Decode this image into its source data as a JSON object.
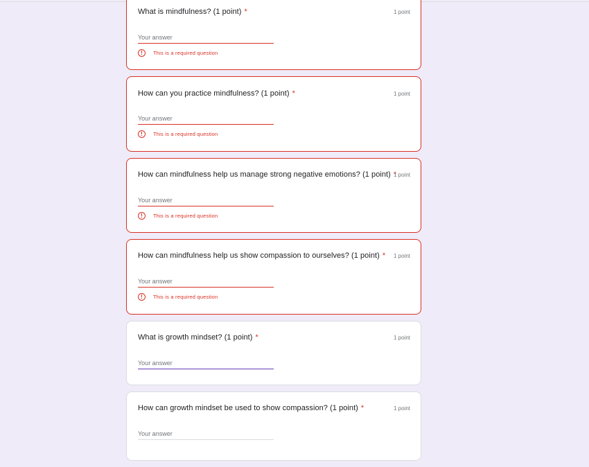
{
  "form": {
    "questions": [
      {
        "title": "What is mindfulness? (1 point)",
        "required_mark": "*",
        "points": "1 point",
        "answer_placeholder": "Your answer",
        "error": "This is a required question",
        "error_icon": "exclamation-circle-icon"
      },
      {
        "title": "How can you practice mindfulness? (1 point)",
        "required_mark": "*",
        "points": "1 point",
        "answer_placeholder": "Your answer",
        "error": "This is a required question",
        "error_icon": "exclamation-circle-icon"
      },
      {
        "title": "How can mindfulness help us manage strong negative emotions? (1 point)",
        "required_mark": "*",
        "points": "1 point",
        "answer_placeholder": "Your answer",
        "error": "This is a required question",
        "error_icon": "exclamation-circle-icon"
      },
      {
        "title": "How can mindfulness help us show compassion to ourselves? (1 point)",
        "required_mark": "*",
        "points": "1 point",
        "answer_placeholder": "Your answer",
        "error": "This is a required question",
        "error_icon": "exclamation-circle-icon"
      },
      {
        "title": "What is growth mindset? (1 point)",
        "required_mark": "*",
        "points": "1 point",
        "answer_placeholder": "Your answer"
      },
      {
        "title": "How can growth mindset be used to show compassion? (1 point)",
        "required_mark": "*",
        "points": "1 point",
        "answer_placeholder": "Your answer"
      }
    ]
  },
  "colors": {
    "background": "#f0ebf8",
    "error": "#d93025",
    "focus": "#673ab7"
  }
}
